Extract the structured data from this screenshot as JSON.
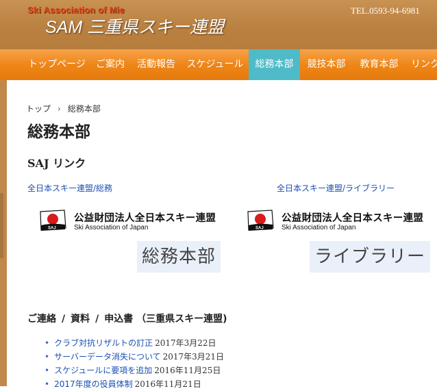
{
  "header": {
    "assoc_en": "Ski Association of Mie",
    "title": "SAM 三重県スキー連盟",
    "tel": "TEL.0593-94-6981"
  },
  "nav": {
    "items": [
      {
        "label": "トップページ",
        "active": false
      },
      {
        "label": "ご案内",
        "active": false
      },
      {
        "label": "活動報告",
        "active": false
      },
      {
        "label": "スケジュール",
        "active": false
      },
      {
        "label": "総務本部",
        "active": true
      },
      {
        "label": "競技本部",
        "active": false
      },
      {
        "label": "教育本部",
        "active": false
      },
      {
        "label": "リンク",
        "active": false
      }
    ]
  },
  "breadcrumb": {
    "top": "トップ",
    "separator": "›",
    "current": "総務本部"
  },
  "page_title": "総務本部",
  "saj_section": {
    "heading": "SAJ リンク",
    "left_link": "全日本スキー連盟/総務",
    "right_link": "全日本スキー連盟/ライブラリー",
    "logo_jp": "公益財団法人全日本スキー連盟",
    "logo_en": "Ski Association of Japan",
    "logo_mark": "SAJ",
    "left_button": "総務本部",
    "right_button": "ライブラリー"
  },
  "contact": {
    "part1": "ご連絡",
    "part2": "資料",
    "part3": "申込書 （三重県スキー連盟)",
    "slash": "/"
  },
  "news": [
    {
      "title": "クラブ対抗リザルトの訂正",
      "date": "2017年3月22日"
    },
    {
      "title": "サーバーデータ消失について",
      "date": "2017年3月21日"
    },
    {
      "title": "スケジュールに要項を追加",
      "date": "2016年11月25日"
    },
    {
      "title": "2017年度の役員体制",
      "date": "2016年11月21日"
    }
  ],
  "colors": {
    "header_brown": "#b98040",
    "nav_orange": "#ef8618",
    "nav_active": "#4fbac8",
    "link_blue": "#1a4fb3",
    "button_bg": "#e9f0f9"
  }
}
